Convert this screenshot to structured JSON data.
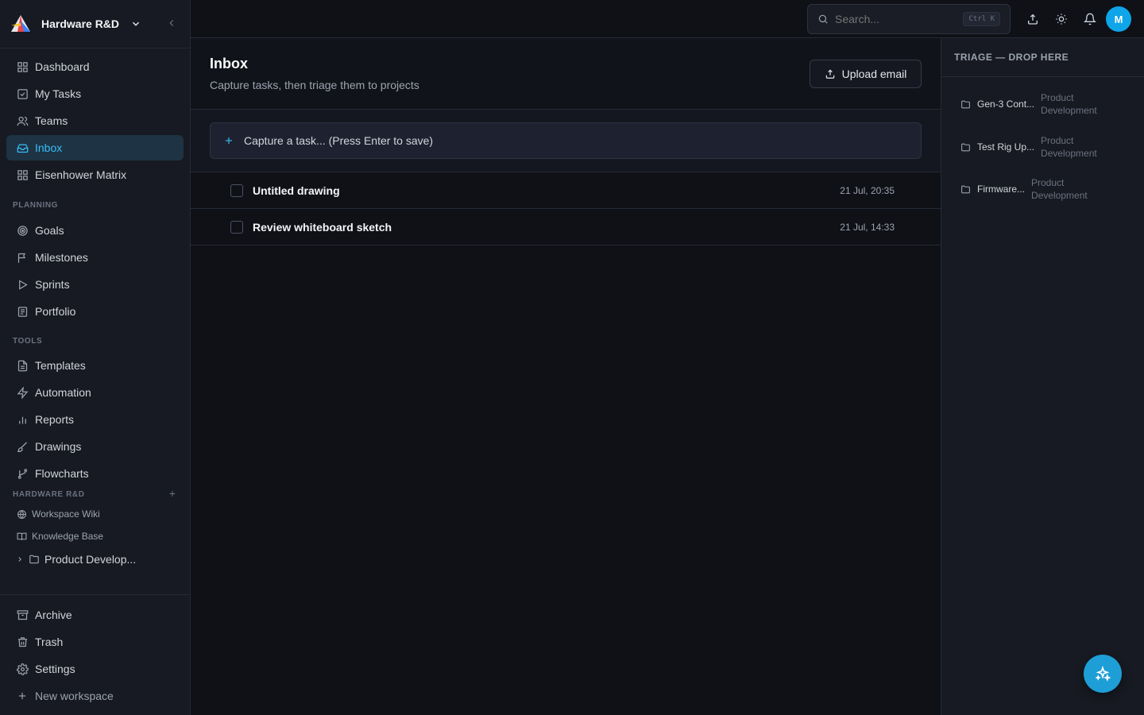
{
  "workspace": {
    "name": "Hardware R&D"
  },
  "nav": {
    "main": [
      {
        "label": "Dashboard"
      },
      {
        "label": "My Tasks"
      },
      {
        "label": "Teams"
      },
      {
        "label": "Inbox"
      },
      {
        "label": "Eisenhower Matrix"
      }
    ],
    "planning_label": "PLANNING",
    "planning": [
      {
        "label": "Goals"
      },
      {
        "label": "Milestones"
      },
      {
        "label": "Sprints"
      },
      {
        "label": "Portfolio"
      }
    ],
    "tools_label": "TOOLS",
    "tools": [
      {
        "label": "Templates"
      },
      {
        "label": "Automation"
      },
      {
        "label": "Reports"
      },
      {
        "label": "Drawings"
      },
      {
        "label": "Flowcharts"
      }
    ],
    "workspace_label": "HARDWARE R&D",
    "workspace_items": [
      {
        "label": "Workspace Wiki"
      },
      {
        "label": "Knowledge Base"
      },
      {
        "label": "Product Develop..."
      }
    ],
    "bottom": [
      {
        "label": "Archive"
      },
      {
        "label": "Trash"
      },
      {
        "label": "Settings"
      },
      {
        "label": "New workspace"
      }
    ]
  },
  "topbar": {
    "search_placeholder": "Search...",
    "search_shortcut": "Ctrl K",
    "avatar_initial": "M"
  },
  "page": {
    "title": "Inbox",
    "subtitle": "Capture tasks, then triage them to projects",
    "upload_label": "Upload email",
    "capture_placeholder": "Capture a task... (Press Enter to save)"
  },
  "tasks": [
    {
      "title": "Untitled drawing",
      "date": "21 Jul, 20:35"
    },
    {
      "title": "Review whiteboard sketch",
      "date": "21 Jul, 14:33"
    }
  ],
  "triage": {
    "title": "TRIAGE — DROP HERE",
    "items": [
      {
        "name": "Gen-3 Cont...",
        "project": "Product Development"
      },
      {
        "name": "Test Rig Up...",
        "project": "Product Development"
      },
      {
        "name": "Firmware...",
        "project": "Product Development"
      }
    ]
  },
  "colors": {
    "accent": "#38bdf8",
    "fab": "#1e9ed6",
    "avatar": "#0ea5e9"
  }
}
